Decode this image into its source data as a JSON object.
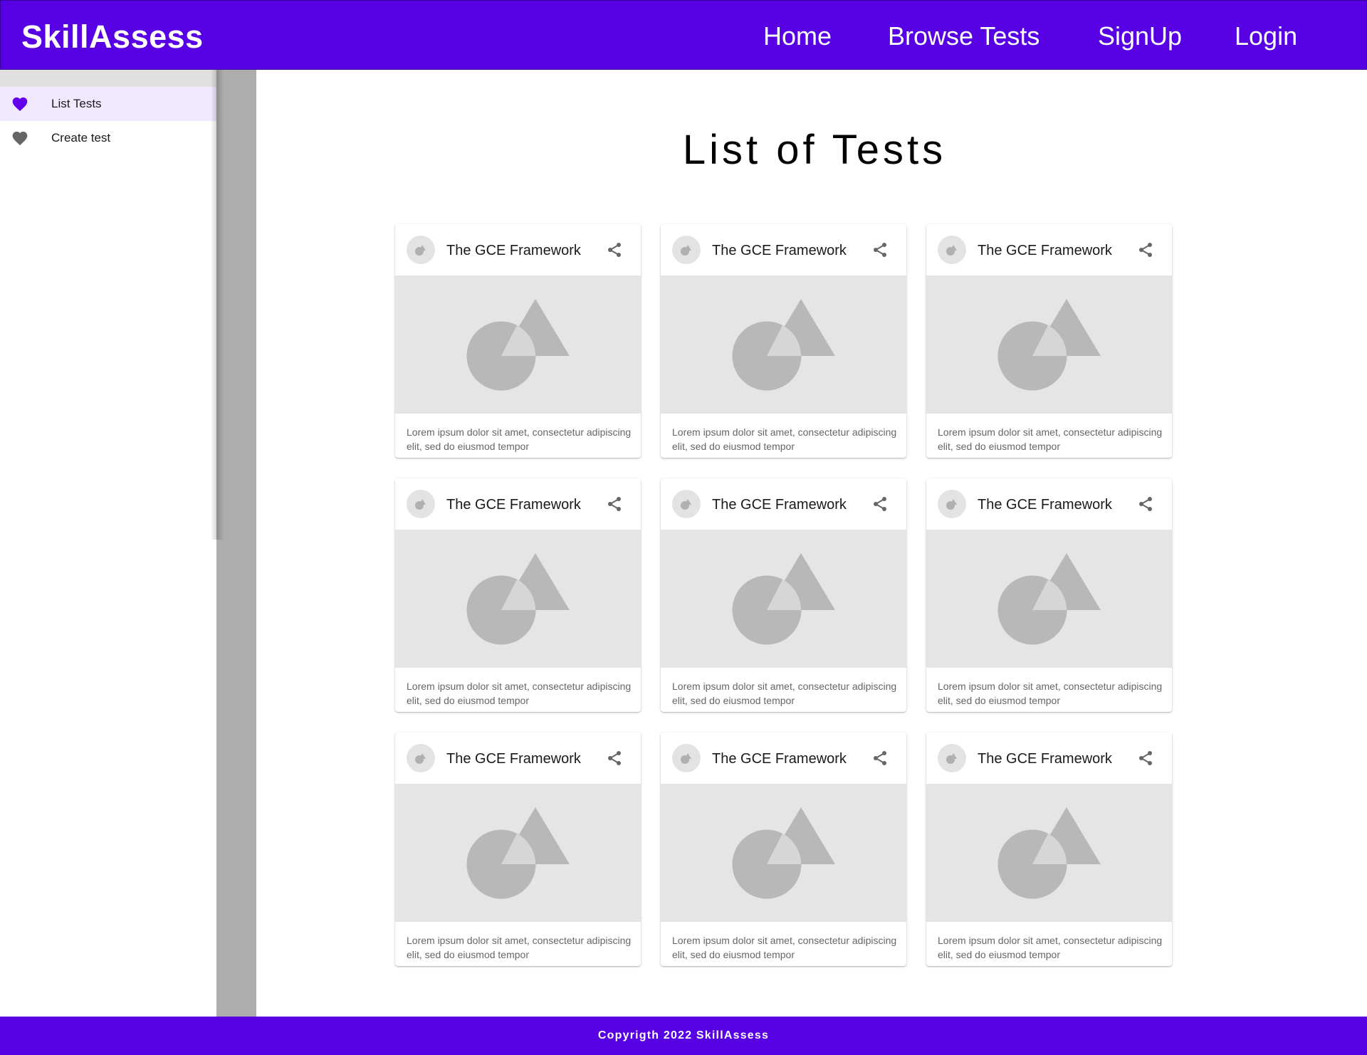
{
  "header": {
    "brand": "SkillAssess",
    "nav": [
      {
        "label": "Home"
      },
      {
        "label": "Browse Tests"
      },
      {
        "label": "SignUp"
      },
      {
        "label": "Login"
      }
    ]
  },
  "sidebar": {
    "items": [
      {
        "label": "List Tests",
        "icon": "heart-icon",
        "active": true
      },
      {
        "label": "Create test",
        "icon": "heart-icon",
        "active": false
      }
    ]
  },
  "main": {
    "title": "List of Tests",
    "cards": [
      {
        "title": "The GCE Framework",
        "text": "Lorem ipsum dolor sit amet, consectetur adipiscing elit, sed do eiusmod tempor"
      },
      {
        "title": "The GCE Framework",
        "text": "Lorem ipsum dolor sit amet, consectetur adipiscing elit, sed do eiusmod tempor"
      },
      {
        "title": "The GCE Framework",
        "text": "Lorem ipsum dolor sit amet, consectetur adipiscing elit, sed do eiusmod tempor"
      },
      {
        "title": "The GCE Framework",
        "text": "Lorem ipsum dolor sit amet, consectetur adipiscing elit, sed do eiusmod tempor"
      },
      {
        "title": "The GCE Framework",
        "text": "Lorem ipsum dolor sit amet, consectetur adipiscing elit, sed do eiusmod tempor"
      },
      {
        "title": "The GCE Framework",
        "text": "Lorem ipsum dolor sit amet, consectetur adipiscing elit, sed do eiusmod tempor"
      },
      {
        "title": "The GCE Framework",
        "text": "Lorem ipsum dolor sit amet, consectetur adipiscing elit, sed do eiusmod tempor"
      },
      {
        "title": "The GCE Framework",
        "text": "Lorem ipsum dolor sit amet, consectetur adipiscing elit, sed do eiusmod tempor"
      },
      {
        "title": "The GCE Framework",
        "text": "Lorem ipsum dolor sit amet, consectetur adipiscing elit, sed do eiusmod tempor"
      }
    ]
  },
  "footer": {
    "text": "Copyrigth 2022 SkillAssess"
  },
  "colors": {
    "brand": "#5800e4",
    "active_item_bg": "#f1e9ff",
    "placeholder_shape": "#b8b8b8",
    "placeholder_bg": "#e5e5e5"
  }
}
